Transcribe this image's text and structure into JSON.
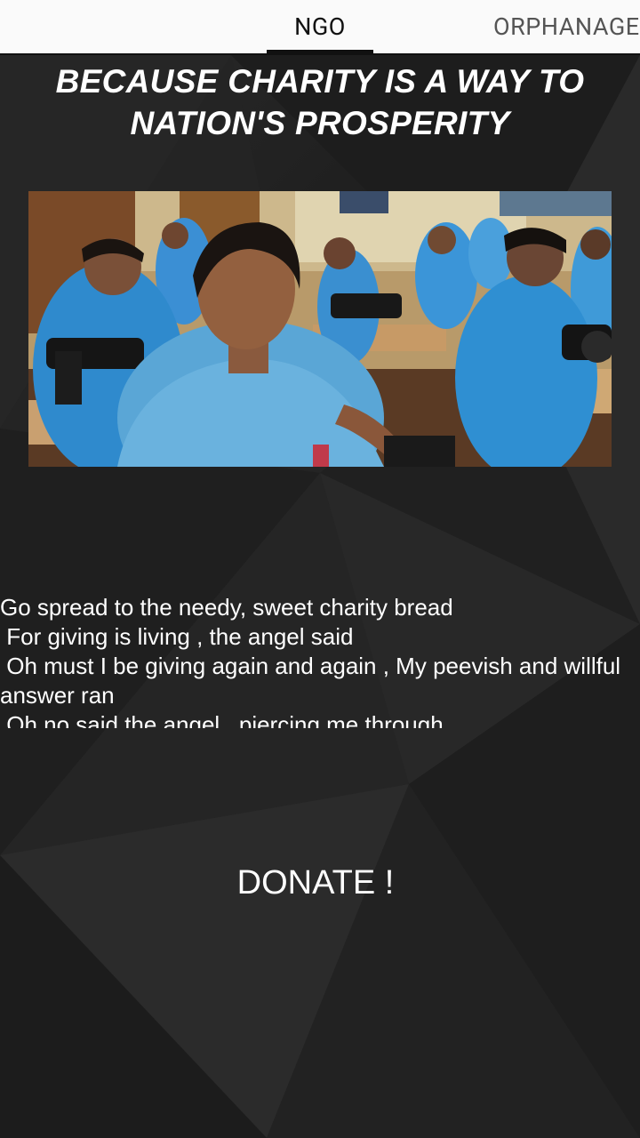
{
  "tabs": [
    {
      "label": "NGO",
      "selected": true
    },
    {
      "label": "ORPHANAGE",
      "selected": false
    }
  ],
  "headline": "BECAUSE CHARITY IS A WAY TO NATION'S PROSPERITY",
  "photo": {
    "icon": "photo-of-women-sewing"
  },
  "poem": "Go spread to the needy, sweet charity bread\n For giving is living , the angel said\n Oh must I be giving again and again , My peevish and willful answer ran\n Oh no said the angel , piercing me through",
  "donate_label": "DONATE !",
  "colors": {
    "tab_bar": "#fafafa",
    "background": "#232323",
    "text": "#ffffff",
    "indicator": "#111111"
  }
}
